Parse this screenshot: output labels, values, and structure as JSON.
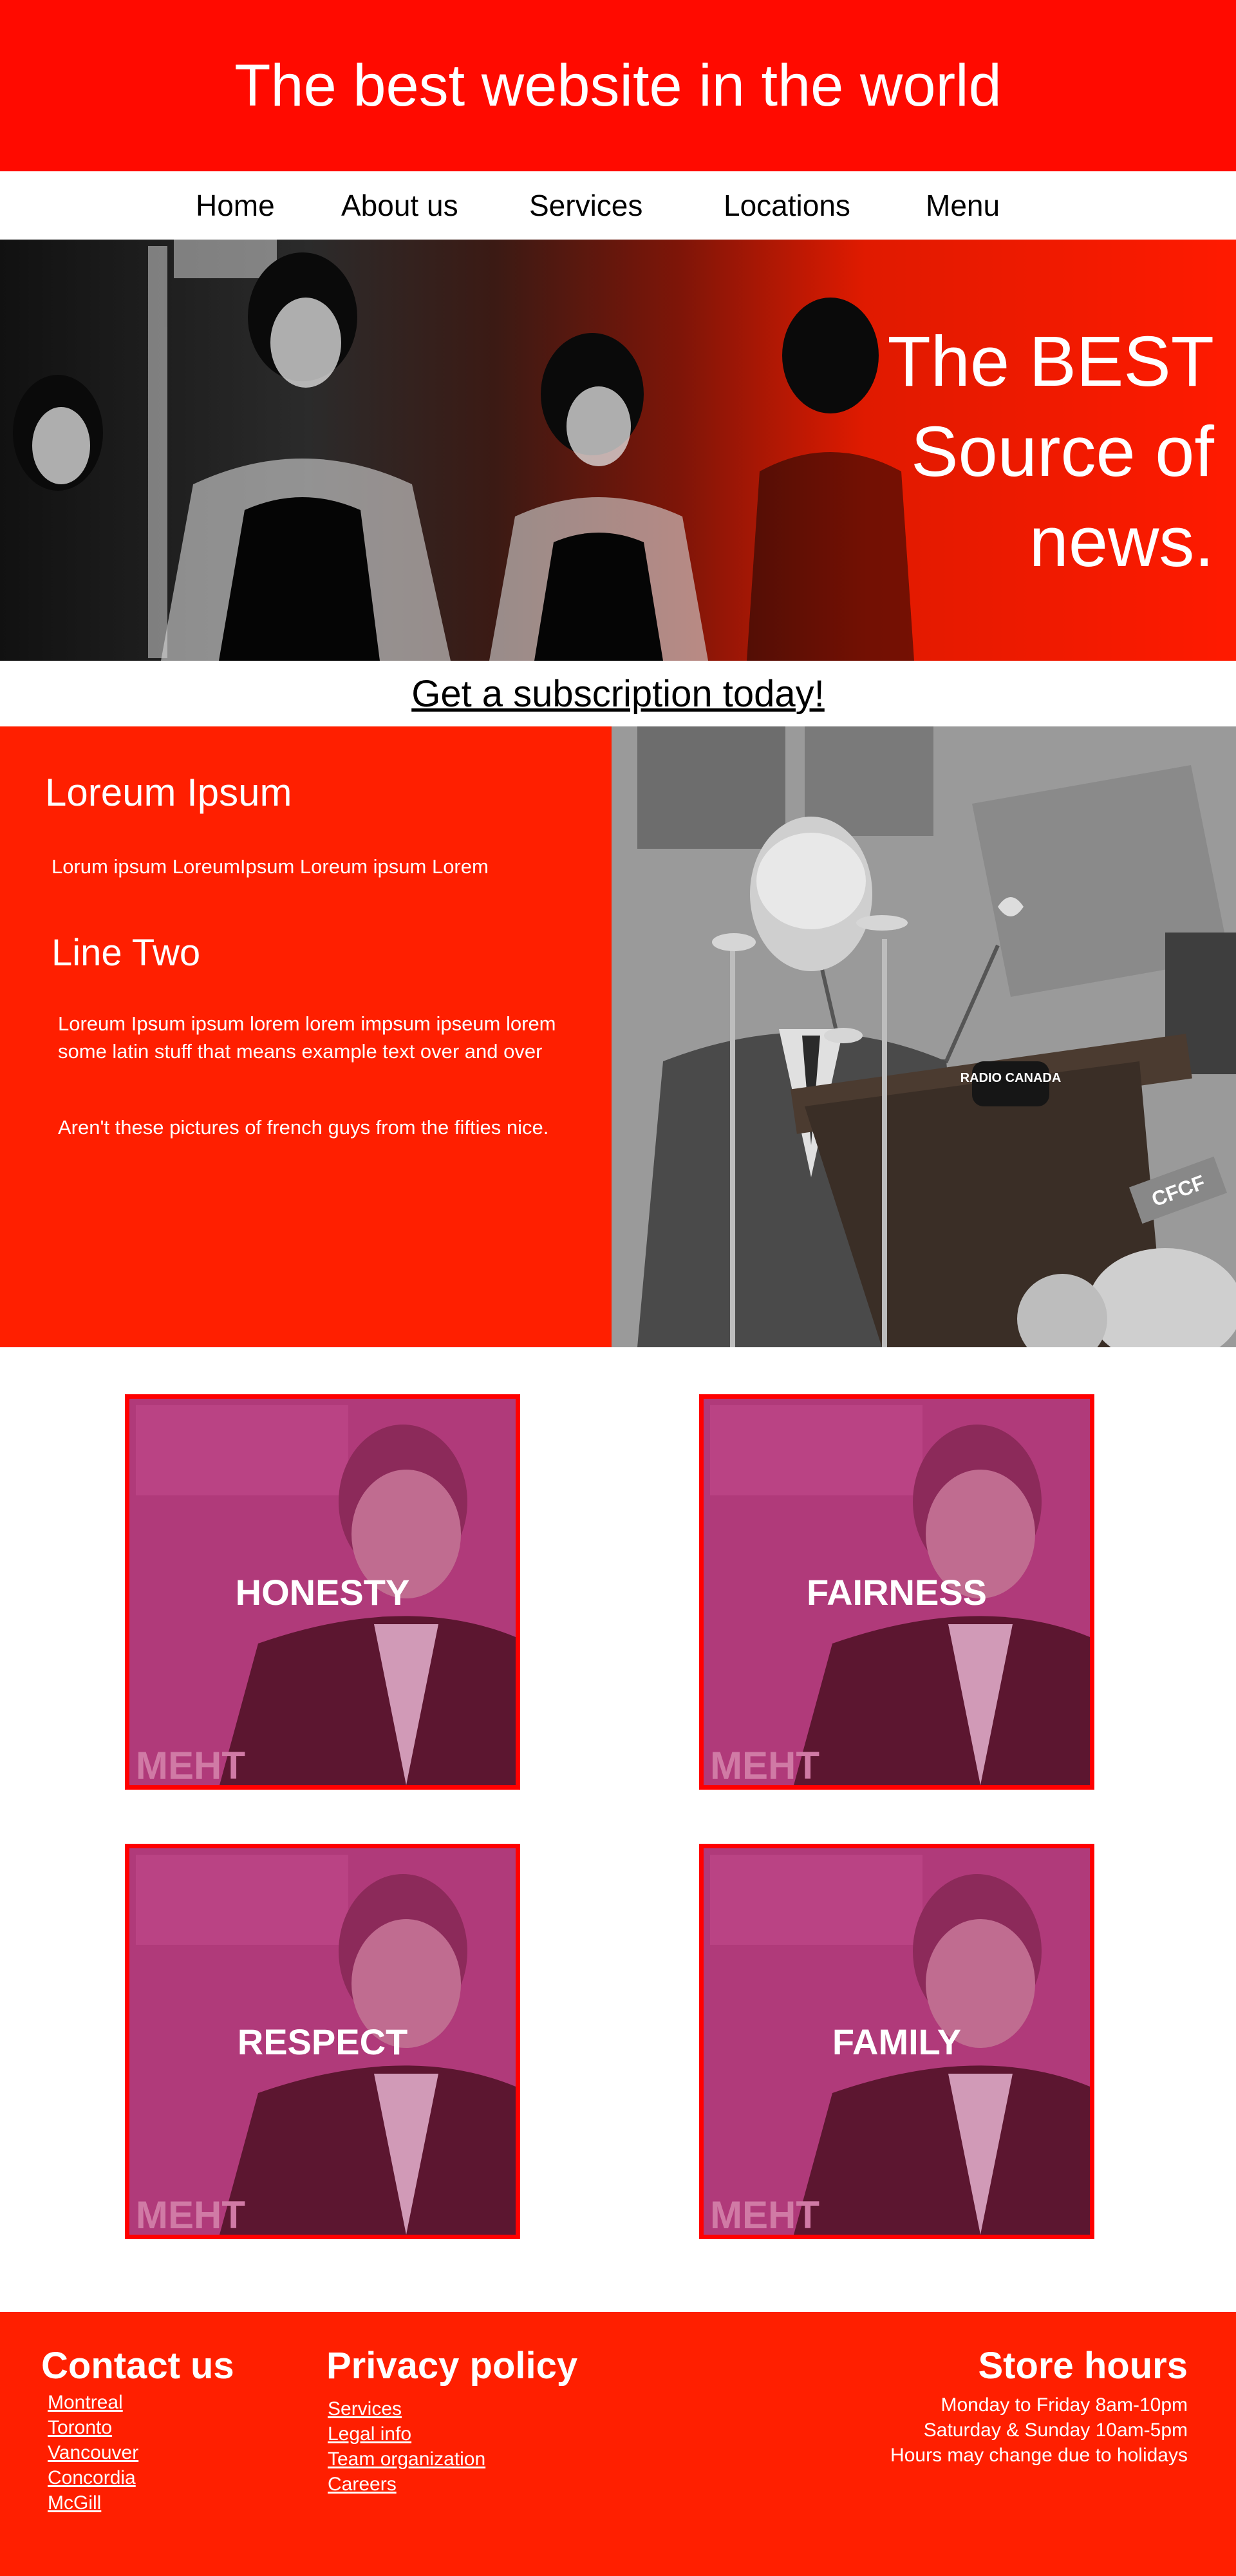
{
  "header": {
    "title": "The best website in the world"
  },
  "nav": {
    "items": [
      "Home",
      "About us",
      "Services",
      "Locations",
      "Menu"
    ]
  },
  "hero": {
    "line1": "The BEST",
    "line2": "Source of",
    "line3": "news."
  },
  "subscription": {
    "label": "Get a subscription today!"
  },
  "middle": {
    "heading": "Loreum Ipsum",
    "small_text": "Lorum ipsum  LoreumIpsum Loreum ipsum Lorem",
    "heading2": "Line Two",
    "paragraph": "Loreum Ipsum ipsum lorem lorem impsum ipseum lorem some latin stuff that means example text over and over",
    "paragraph2": "Aren't these pictures of french guys from the fifties nice.",
    "photo_labels": {
      "sign1": "RADIO CANADA",
      "sign2": "CFCF"
    }
  },
  "cards": [
    {
      "label": "HONESTY"
    },
    {
      "label": "FAIRNESS"
    },
    {
      "label": "RESPECT"
    },
    {
      "label": "FAMILY"
    }
  ],
  "card_bg_text": "МЕНТ",
  "footer": {
    "contact": {
      "title": "Contact us",
      "links": [
        "Montreal",
        "Toronto",
        "Vancouver",
        "Concordia",
        "McGill"
      ]
    },
    "privacy": {
      "title": "Privacy policy",
      "links": [
        "Services",
        "Legal info",
        "Team organization",
        "Careers"
      ]
    },
    "hours": {
      "title": "Store hours",
      "lines": [
        "Monday to Friday 8am-10pm",
        "Saturday & Sunday 10am-5pm",
        "Hours may change due to holidays"
      ]
    }
  },
  "colors": {
    "primary_red": "#ff0a00",
    "footer_red": "#ff1f00",
    "card_overlay": "#b03a7a"
  }
}
